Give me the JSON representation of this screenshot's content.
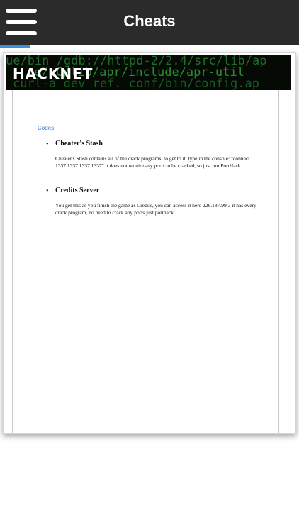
{
  "header": {
    "title": "Cheats",
    "menu_icon": "hamburger-menu-icon"
  },
  "banner": {
    "logo_text": "HACKNET",
    "code_lines": [
      "ue/bin /gdb://httpd-2/2.4/src/lib/ap",
      "e/aC/lib/apr/include/apr-util",
      "curl-a dev ref. conf/bin/config.ap"
    ]
  },
  "content": {
    "link_text": "Codes",
    "items": [
      {
        "title": "Cheater's Stash",
        "body": "Cheater's Stash contains all of the crack programs. to get to it, type in the console: \"connect 1337.1337.1337.1337\" it does not require any ports to be cracked, so just run PortHack."
      },
      {
        "title": "Credits Server",
        "body": "You get this as you finish the game as Credits, you can access it here 226.187.99.3 it has every crack program, no need to crack any ports just porthack."
      }
    ]
  },
  "colors": {
    "topbar": "#2b2b2b",
    "accent": "#3d8fd8",
    "link": "#3a7ad0",
    "banner_code": "#1f7a2a"
  }
}
